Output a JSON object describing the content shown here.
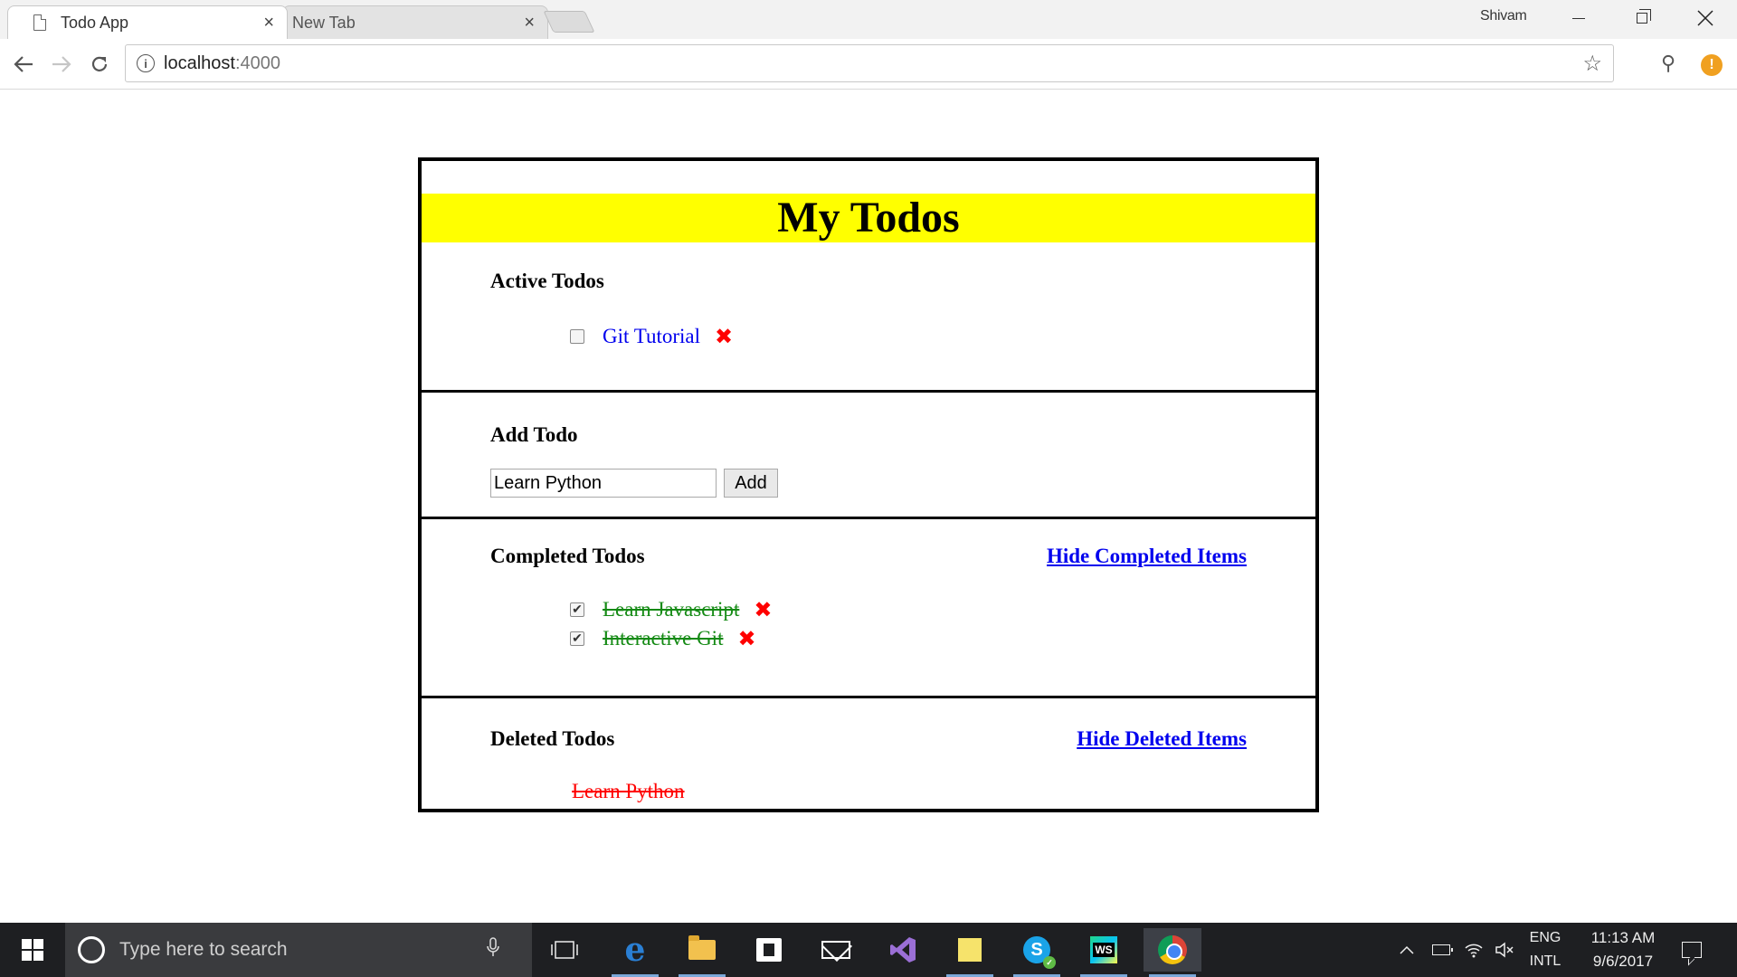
{
  "browser": {
    "tabs": [
      {
        "label": "Todo App",
        "close": "×"
      },
      {
        "label": "New Tab",
        "close": "×"
      }
    ],
    "profile_name": "Shivam",
    "url_host": "localhost",
    "url_port": ":4000"
  },
  "app": {
    "title": "My Todos",
    "active": {
      "title": "Active Todos",
      "items": [
        {
          "text": "Git Tutorial",
          "checked": false
        }
      ]
    },
    "add": {
      "title": "Add Todo",
      "input_value": "Learn Python",
      "button_label": "Add"
    },
    "completed": {
      "title": "Completed Todos",
      "hide_link": "Hide Completed Items",
      "items": [
        {
          "text": "Learn Javascript",
          "checked": true
        },
        {
          "text": "Interactive Git",
          "checked": true
        }
      ]
    },
    "deleted": {
      "title": "Deleted Todos",
      "hide_link": "Hide Deleted Items",
      "items": [
        {
          "text": "Learn Python"
        }
      ]
    },
    "delete_glyph": "✖",
    "check_glyph": "✔"
  },
  "colors": {
    "header_bg": "#ffff00",
    "link": "#0000ee",
    "completed_text": "#148a14",
    "deleted_text": "#ff0000",
    "delete_icon": "#ff0000"
  },
  "taskbar": {
    "search_placeholder": "Type here to search",
    "language_top": "ENG",
    "language_bottom": "INTL",
    "time": "11:13 AM",
    "date": "9/6/2017",
    "pinned_icons": [
      "task-view-icon",
      "edge-icon",
      "file-explorer-icon",
      "store-icon",
      "mail-icon",
      "visual-studio-icon",
      "sticky-notes-icon",
      "skype-icon",
      "webstorm-icon",
      "chrome-icon"
    ]
  }
}
